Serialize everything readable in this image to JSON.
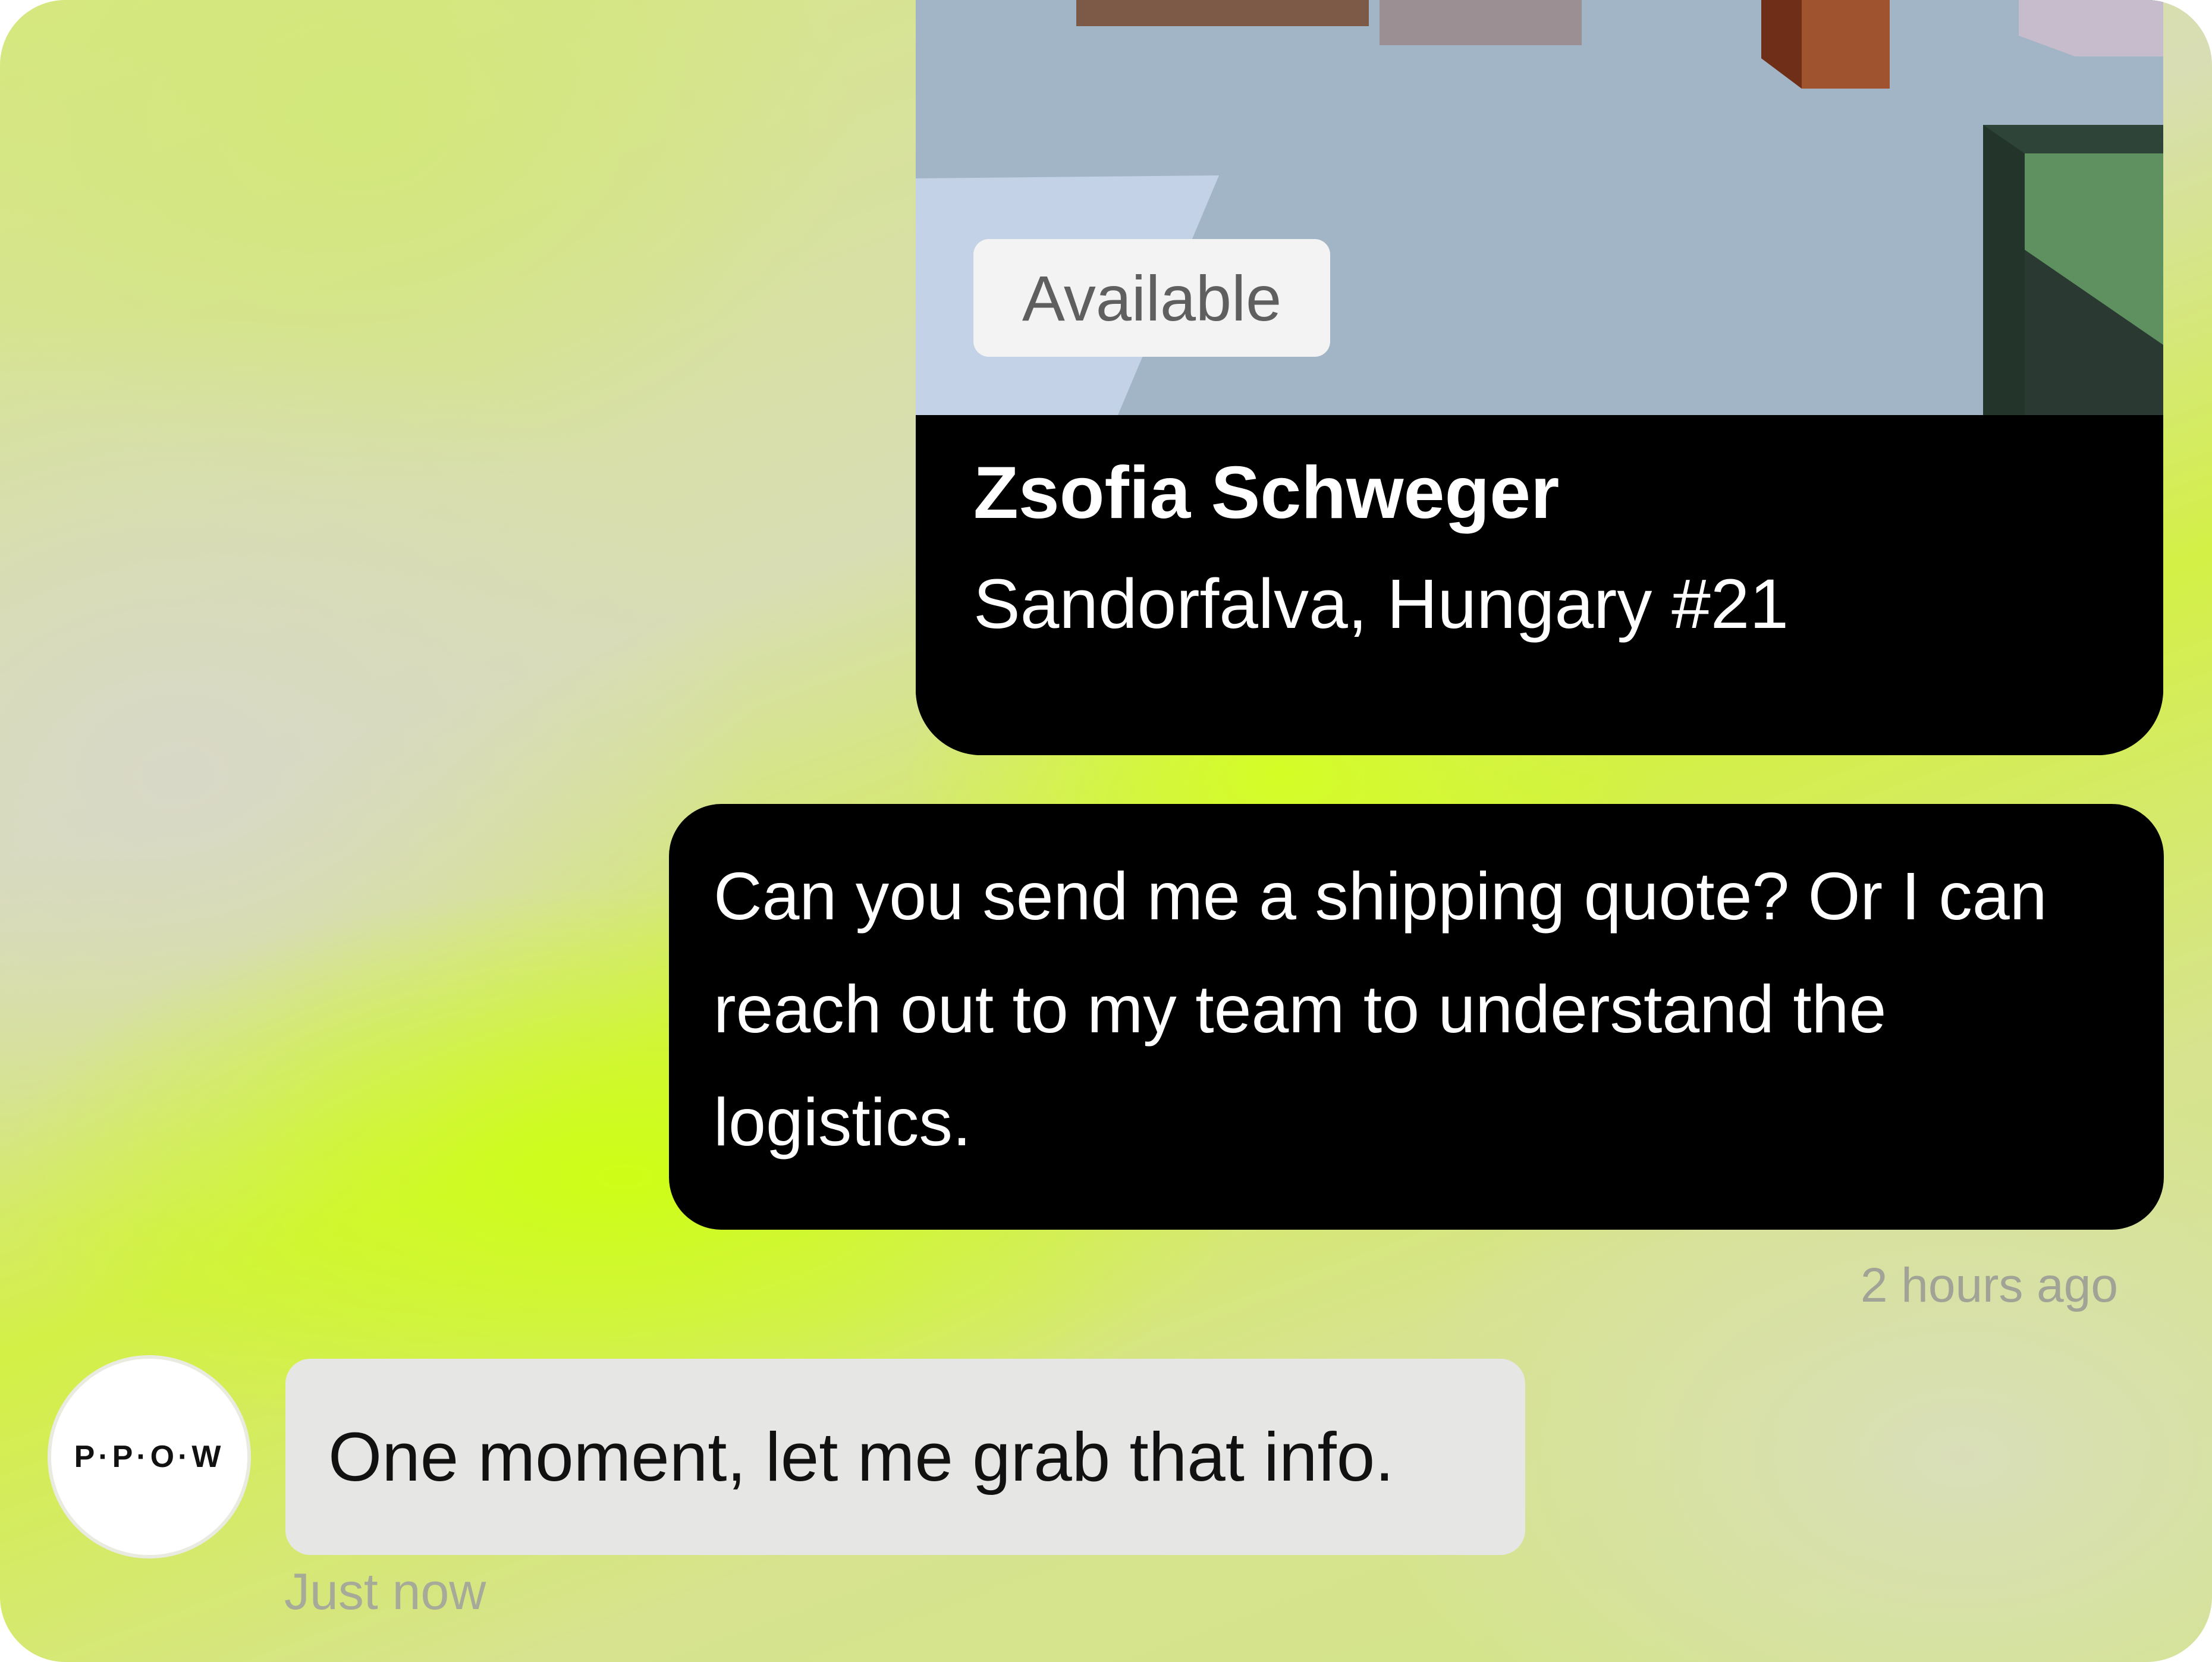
{
  "artwork_card": {
    "status_badge": "Available",
    "artist": "Zsofia Schweger",
    "title": "Sandorfalva, Hungary #21"
  },
  "messages": [
    {
      "direction": "outgoing",
      "text": "Can you send me a shipping quote? Or I can reach out to my team to understand the logistics.",
      "timestamp": "2 hours ago"
    },
    {
      "direction": "incoming",
      "sender_avatar_text": "P·P·O·W",
      "text": "One moment, let me grab that info.",
      "timestamp": "Just now"
    }
  ],
  "colors": {
    "accent_lime": "#ccff1a",
    "bubble_outgoing": "#000000",
    "bubble_incoming": "#e6e6e4"
  }
}
